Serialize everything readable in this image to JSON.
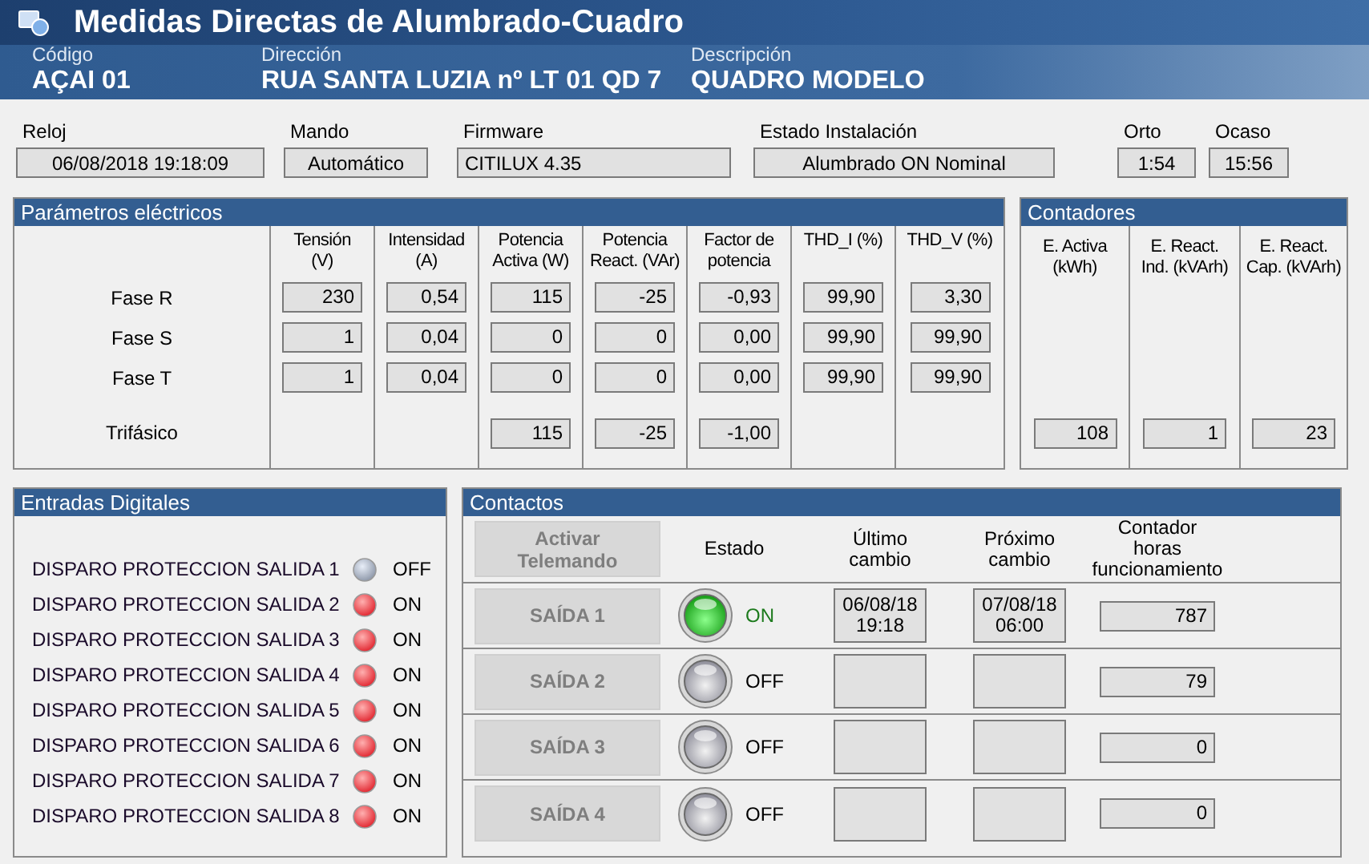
{
  "window": {
    "title": "Medidas Directas de Alumbrado-Cuadro"
  },
  "header": {
    "fields": [
      {
        "label": "Código",
        "value": "AÇAI 01"
      },
      {
        "label": "Dirección",
        "value": "RUA SANTA LUZIA nº LT 01 QD 7"
      },
      {
        "label": "Descripción",
        "value": "QUADRO MODELO"
      }
    ]
  },
  "status_fields": [
    {
      "label": "Reloj",
      "value": "06/08/2018 19:18:09"
    },
    {
      "label": "Mando",
      "value": "Automático"
    },
    {
      "label": "Firmware",
      "value": "CITILUX 4.35"
    },
    {
      "label": "Estado Instalación",
      "value": "Alumbrado ON Nominal"
    },
    {
      "label": "Orto",
      "value": "1:54"
    },
    {
      "label": "Ocaso",
      "value": "15:56"
    }
  ],
  "electrical": {
    "title": "Parámetros eléctricos",
    "row_labels": [
      "Fase R",
      "Fase S",
      "Fase T",
      "Trifásico"
    ],
    "columns": [
      {
        "label": "Tensión\n(V)",
        "phases": [
          "230",
          "1",
          "1"
        ]
      },
      {
        "label": "Intensidad\n(A)",
        "phases": [
          "0,54",
          "0,04",
          "0,04"
        ]
      },
      {
        "label": "Potencia\nActiva (W)",
        "phases": [
          "115",
          "0",
          "0"
        ],
        "total": "115"
      },
      {
        "label": "Potencia\nReact. (VAr)",
        "phases": [
          "-25",
          "0",
          "0"
        ],
        "total": "-25"
      },
      {
        "label": "Factor de\npotencia",
        "phases": [
          "-0,93",
          "0,00",
          "0,00"
        ],
        "total": "-1,00"
      },
      {
        "label": "THD_I (%)",
        "phases": [
          "99,90",
          "99,90",
          "99,90"
        ]
      },
      {
        "label": "THD_V (%)",
        "phases": [
          "3,30",
          "99,90",
          "99,90"
        ]
      }
    ]
  },
  "counters": {
    "title": "Contadores",
    "columns": [
      {
        "label": "E. Activa\n(kWh)",
        "value": "108"
      },
      {
        "label": "E. React.\nInd. (kVArh)",
        "value": "1"
      },
      {
        "label": "E. React.\nCap. (kVArh)",
        "value": "23"
      }
    ]
  },
  "digital_inputs": {
    "title": "Entradas Digitales",
    "items": [
      {
        "label": "DISPARO PROTECCION SALIDA 1",
        "on": false,
        "state": "OFF"
      },
      {
        "label": "DISPARO PROTECCION SALIDA 2",
        "on": true,
        "state": "ON"
      },
      {
        "label": "DISPARO PROTECCION SALIDA 3",
        "on": true,
        "state": "ON"
      },
      {
        "label": "DISPARO PROTECCION SALIDA 4",
        "on": true,
        "state": "ON"
      },
      {
        "label": "DISPARO PROTECCION SALIDA 5",
        "on": true,
        "state": "ON"
      },
      {
        "label": "DISPARO PROTECCION SALIDA 6",
        "on": true,
        "state": "ON"
      },
      {
        "label": "DISPARO PROTECCION SALIDA 7",
        "on": true,
        "state": "ON"
      },
      {
        "label": "DISPARO PROTECCION SALIDA 8",
        "on": true,
        "state": "ON"
      }
    ]
  },
  "contacts": {
    "title": "Contactos",
    "activate_button": {
      "label": "Activar\nTelemando",
      "disabled": true
    },
    "columns": [
      "Estado",
      "Último\ncambio",
      "Próximo\ncambio",
      "Contador\nhoras\nfuncionamiento"
    ],
    "rows": [
      {
        "button": "SAÍDA 1",
        "disabled": true,
        "on": true,
        "state": "ON",
        "last_change": "06/08/18\n19:18",
        "next_change": "07/08/18\n06:00",
        "hours": "787"
      },
      {
        "button": "SAÍDA 2",
        "disabled": true,
        "on": false,
        "state": "OFF",
        "hours": "79"
      },
      {
        "button": "SAÍDA 3",
        "disabled": true,
        "on": false,
        "state": "OFF",
        "hours": "0"
      },
      {
        "button": "SAÍDA 4",
        "disabled": true,
        "on": false,
        "state": "OFF",
        "hours": "0"
      }
    ]
  }
}
